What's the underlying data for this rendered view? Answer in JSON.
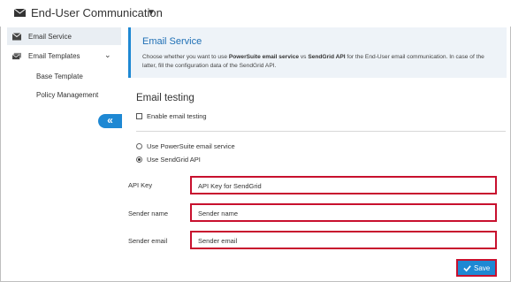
{
  "header": {
    "title": "End-User Communication"
  },
  "sidebar": {
    "items": [
      {
        "label": "Email Service",
        "icon": "envelope-icon",
        "active": true
      },
      {
        "label": "Email Templates",
        "icon": "envelopes-icon"
      }
    ],
    "subitems": [
      "Base Template",
      "Policy Management"
    ],
    "collapse_label": "«"
  },
  "info": {
    "title": "Email Service",
    "text_1": "Choose whether you want to use ",
    "bold_1": "PowerSuite email service",
    "text_2": " vs ",
    "bold_2": "SendGrid API",
    "text_3": " for the End-User email communication. In case of the latter, fill the configuration data of the SendGrid API."
  },
  "testing": {
    "title": "Email testing",
    "enable_label": "Enable email testing",
    "enabled": false
  },
  "service": {
    "options": [
      "Use PowerSuite email service",
      "Use SendGrid API"
    ],
    "selected": "Use SendGrid API"
  },
  "fields": [
    {
      "label": "API Key",
      "value": "API Key for SendGrid"
    },
    {
      "label": "Sender name",
      "value": "Sender name"
    },
    {
      "label": "Sender email",
      "value": "Sender email"
    }
  ],
  "save_label": "Save",
  "colors": {
    "accent": "#1e88d3",
    "highlight": "#c8102e",
    "active_bg": "#e9eef3"
  }
}
